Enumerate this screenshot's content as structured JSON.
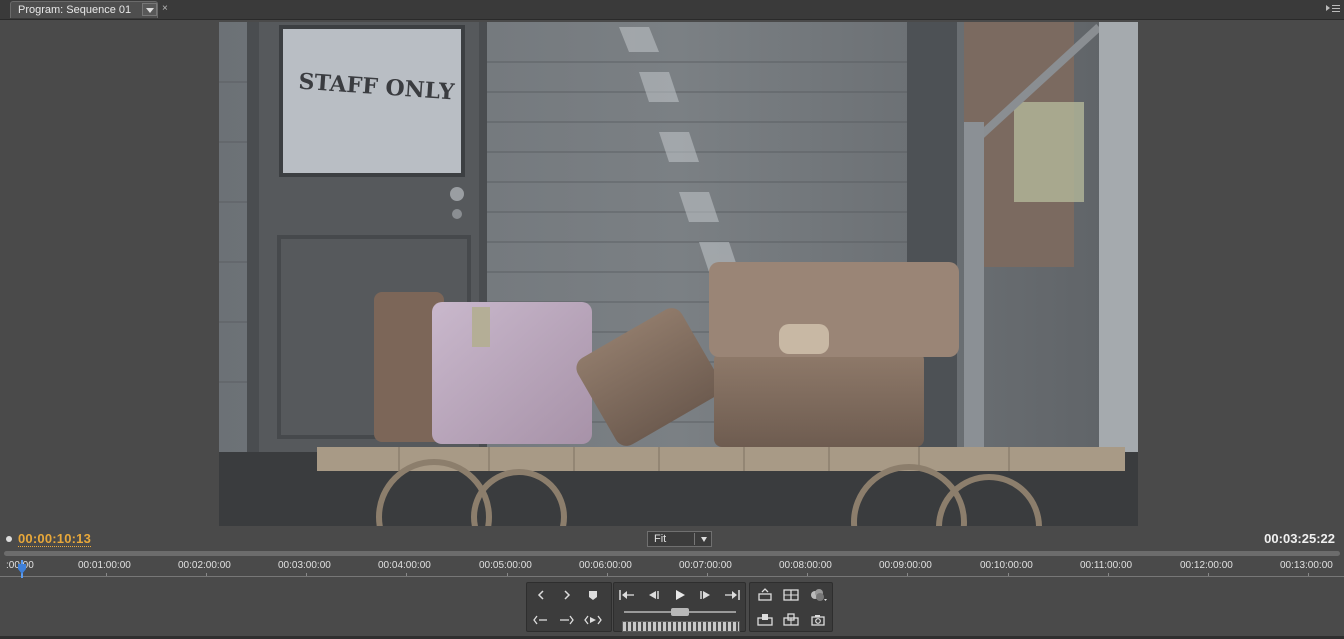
{
  "tab": {
    "title": "Program: Sequence 01",
    "close": "×"
  },
  "video_frame": {
    "sign_text": "STAFF ONLY"
  },
  "timecode": {
    "current": "00:00:10:13",
    "duration": "00:03:25:22"
  },
  "zoom_select": {
    "selected": "Fit"
  },
  "ruler": {
    "labels": [
      ":00:00",
      "00:01:00:00",
      "00:02:00:00",
      "00:03:00:00",
      "00:04:00:00",
      "00:05:00:00",
      "00:06:00:00",
      "00:07:00:00",
      "00:08:00:00",
      "00:09:00:00",
      "00:10:00:00",
      "00:11:00:00",
      "00:12:00:00",
      "00:13:00:00"
    ]
  },
  "controls": {
    "set_in": "set-in-icon",
    "set_out": "set-out-icon",
    "set_marker": "marker-icon",
    "goto_in": "goto-in-icon",
    "step_back": "step-back-icon",
    "play": "play-icon",
    "step_forward": "step-forward-icon",
    "goto_out": "goto-out-icon",
    "lift": "lift-icon",
    "extract": "extract-icon",
    "output": "output-icon"
  },
  "colors": {
    "current_timecode": "#e8a83a",
    "playhead": "#3e7fd8"
  }
}
